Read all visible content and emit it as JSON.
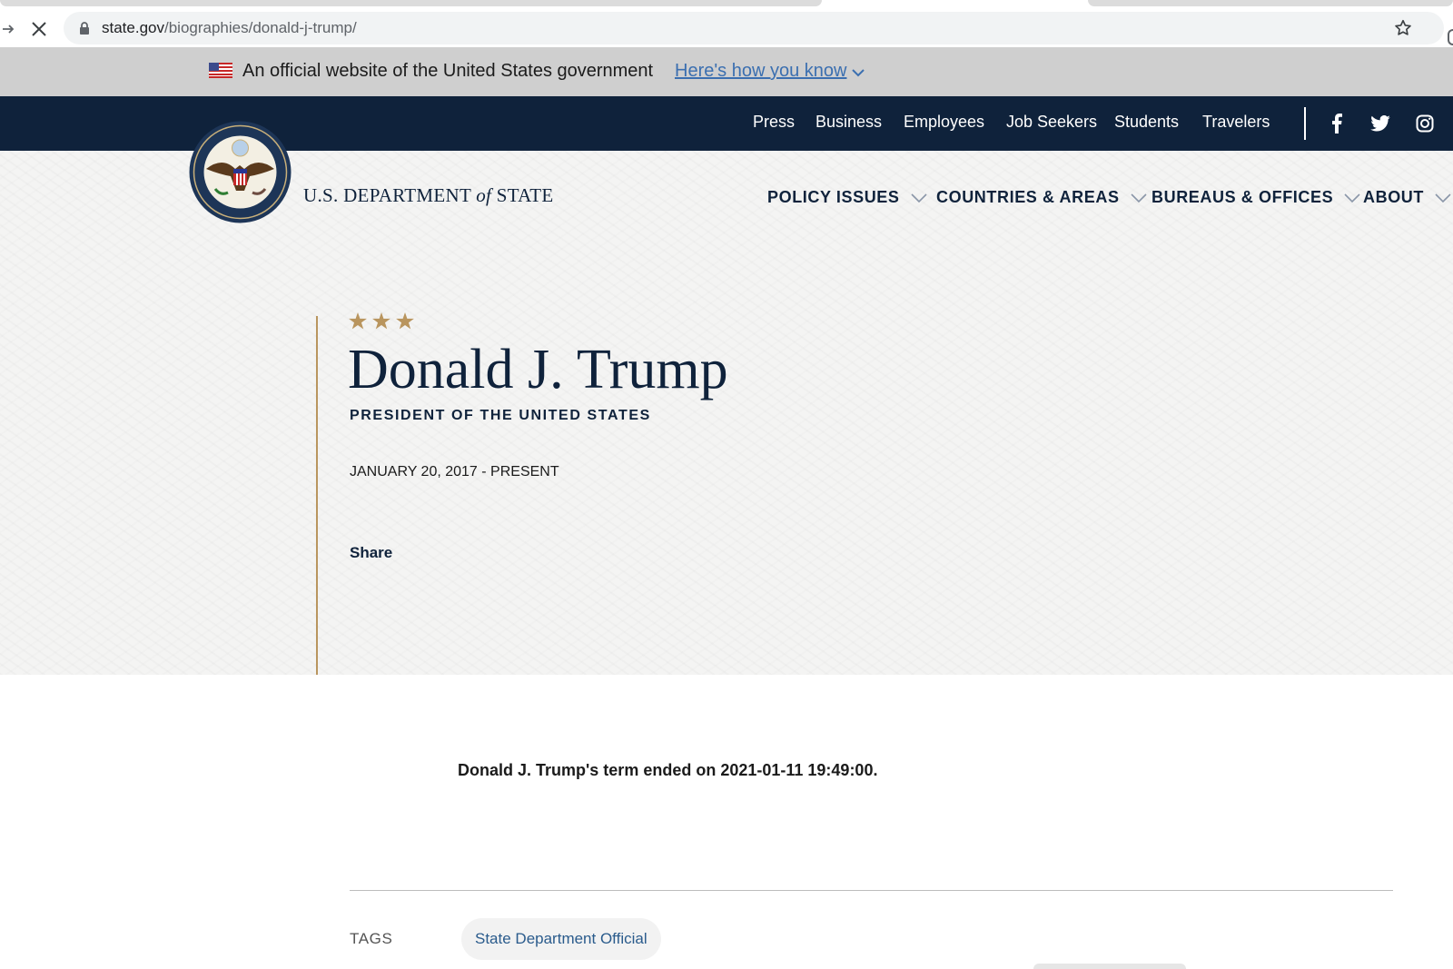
{
  "browser": {
    "url_host": "state.gov",
    "url_path": "/biographies/donald-j-trump/"
  },
  "gov_banner": {
    "text": "An official website of the United States government",
    "link": "Here's how you know"
  },
  "utility_nav": [
    "Press",
    "Business",
    "Employees",
    "Job Seekers",
    "Students",
    "Travelers"
  ],
  "site": {
    "name_pre": "U.S. DEPARTMENT ",
    "name_of": "of",
    "name_post": " STATE"
  },
  "main_nav": [
    "POLICY ISSUES",
    "COUNTRIES & AREAS",
    "BUREAUS & OFFICES",
    "ABOUT"
  ],
  "profile": {
    "name": "Donald J. Trump",
    "role": "PRESIDENT OF THE UNITED STATES",
    "dates": "JANUARY 20, 2017 - PRESENT",
    "share_label": "Share"
  },
  "content": {
    "term_note": "Donald J. Trump's term ended on 2021-01-11 19:49:00."
  },
  "tags": {
    "label": "TAGS",
    "items": [
      "State Department Official"
    ]
  },
  "colors": {
    "navy": "#0f223b",
    "gold": "#b9955e",
    "link_blue": "#3b6fb0",
    "banner_gray": "#cfcfcf"
  },
  "icons": [
    "forward-arrow-icon",
    "close-icon",
    "lock-icon",
    "bookmark-star-icon",
    "us-flag-icon",
    "chevron-down-icon",
    "facebook-icon",
    "twitter-icon",
    "instagram-icon",
    "gold-star-icon"
  ]
}
